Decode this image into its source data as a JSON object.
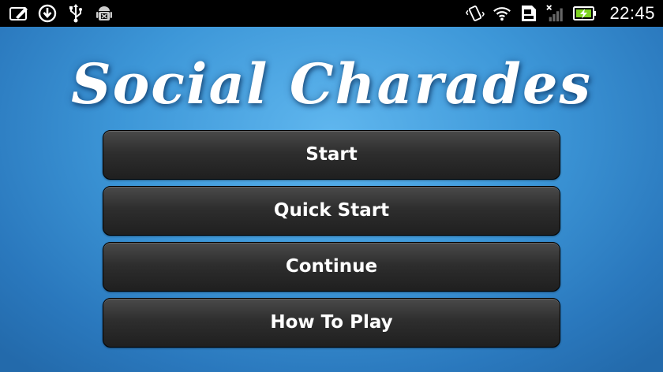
{
  "status_bar": {
    "time": "22:45",
    "left_icons": [
      "edit-icon",
      "download-icon",
      "usb-icon",
      "android-debug-icon"
    ],
    "right_icons": [
      "vibrate-icon",
      "wifi-icon",
      "sim-card-icon",
      "signal-icon",
      "battery-charging-icon"
    ],
    "battery_color": "#7ed321"
  },
  "title": "Social Charades",
  "menu": {
    "buttons": [
      {
        "label": "Start"
      },
      {
        "label": "Quick Start"
      },
      {
        "label": "Continue"
      },
      {
        "label": "How To Play"
      }
    ]
  },
  "colors": {
    "background_center": "#5fb6ee",
    "background_edge": "#236aab",
    "button": "#2e2e2e"
  }
}
